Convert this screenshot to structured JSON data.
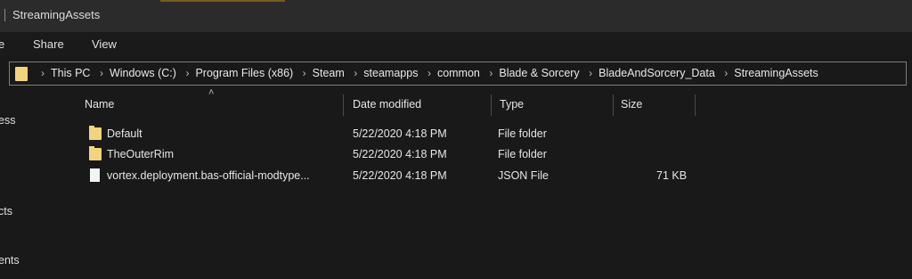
{
  "window": {
    "title": "StreamingAssets"
  },
  "ribbon": {
    "tabs": [
      "e",
      "Share",
      "View"
    ]
  },
  "address": {
    "segments": [
      "This PC",
      "Windows (C:)",
      "Program Files (x86)",
      "Steam",
      "steamapps",
      "common",
      "Blade & Sorcery",
      "BladeAndSorcery_Data",
      "StreamingAssets"
    ]
  },
  "nav": {
    "items": [
      "ess",
      "cts",
      "ents"
    ]
  },
  "columns": {
    "name": "Name",
    "date": "Date modified",
    "type": "Type",
    "size": "Size"
  },
  "files": [
    {
      "name": "Default",
      "date": "5/22/2020 4:18 PM",
      "type": "File folder",
      "size": "",
      "icon": "folder-icon"
    },
    {
      "name": "TheOuterRim",
      "date": "5/22/2020 4:18 PM",
      "type": "File folder",
      "size": "",
      "icon": "folder-icon"
    },
    {
      "name": "vortex.deployment.bas-official-modtype...",
      "date": "5/22/2020 4:18 PM",
      "type": "JSON File",
      "size": "71 KB",
      "icon": "json-file-icon"
    }
  ]
}
